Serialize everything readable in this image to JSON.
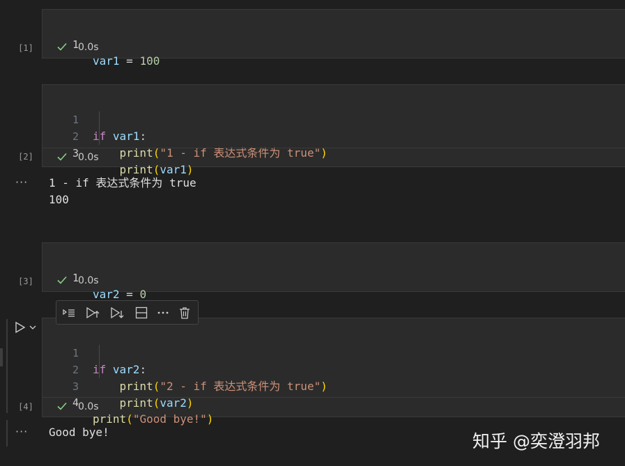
{
  "cells": [
    {
      "exec_count": "[1]",
      "lines": [
        {
          "num": "1",
          "tokens": [
            {
              "t": "var1",
              "c": "v"
            },
            {
              "t": " = ",
              "c": "p"
            },
            {
              "t": "100",
              "c": "n"
            }
          ]
        }
      ],
      "status_time": "0.0s"
    },
    {
      "exec_count": "[2]",
      "lines": [
        {
          "num": "1",
          "tokens": [
            {
              "t": "if",
              "c": "k"
            },
            {
              "t": " ",
              "c": "p"
            },
            {
              "t": "var1",
              "c": "v"
            },
            {
              "t": ":",
              "c": "p"
            }
          ]
        },
        {
          "num": "2",
          "tokens": [
            {
              "t": "    ",
              "c": "p"
            },
            {
              "t": "print",
              "c": "f"
            },
            {
              "t": "(",
              "c": "b"
            },
            {
              "t": "\"1 - if 表达式条件为 true\"",
              "c": "s"
            },
            {
              "t": ")",
              "c": "b"
            }
          ]
        },
        {
          "num": "3",
          "tokens": [
            {
              "t": "    ",
              "c": "p"
            },
            {
              "t": "print",
              "c": "f"
            },
            {
              "t": "(",
              "c": "b"
            },
            {
              "t": "var1",
              "c": "v"
            },
            {
              "t": ")",
              "c": "b"
            }
          ]
        }
      ],
      "status_time": "0.0s",
      "output": "1 - if 表达式条件为 true\n100"
    },
    {
      "exec_count": "[3]",
      "lines": [
        {
          "num": "1",
          "tokens": [
            {
              "t": "var2",
              "c": "v"
            },
            {
              "t": " = ",
              "c": "p"
            },
            {
              "t": "0",
              "c": "n"
            }
          ]
        }
      ],
      "status_time": "0.0s"
    },
    {
      "exec_count": "[4]",
      "lines": [
        {
          "num": "1",
          "tokens": [
            {
              "t": "if",
              "c": "k"
            },
            {
              "t": " ",
              "c": "p"
            },
            {
              "t": "var2",
              "c": "v"
            },
            {
              "t": ":",
              "c": "p"
            }
          ]
        },
        {
          "num": "2",
          "tokens": [
            {
              "t": "    ",
              "c": "p"
            },
            {
              "t": "print",
              "c": "f"
            },
            {
              "t": "(",
              "c": "b"
            },
            {
              "t": "\"2 - if 表达式条件为 true\"",
              "c": "s"
            },
            {
              "t": ")",
              "c": "b"
            }
          ]
        },
        {
          "num": "3",
          "tokens": [
            {
              "t": "    ",
              "c": "p"
            },
            {
              "t": "print",
              "c": "f"
            },
            {
              "t": "(",
              "c": "b"
            },
            {
              "t": "var2",
              "c": "v"
            },
            {
              "t": ")",
              "c": "b"
            }
          ]
        },
        {
          "num": "4",
          "tokens": [
            {
              "t": "print",
              "c": "f"
            },
            {
              "t": "(",
              "c": "b"
            },
            {
              "t": "\"Good bye!\"",
              "c": "s"
            },
            {
              "t": ")",
              "c": "b"
            }
          ]
        }
      ],
      "status_time": "0.0s",
      "output": "Good bye!"
    }
  ],
  "output_menu": "···",
  "toolbar": {
    "icons": [
      "execute-above-icon",
      "run-above-icon",
      "run-below-icon",
      "split-cell-icon",
      "more-icon",
      "delete-icon"
    ]
  },
  "watermark": "知乎 @奕澄羽邦",
  "colors": {
    "keyword": "#c586c0",
    "variable": "#9cdcfe",
    "number": "#b5cea8",
    "function": "#dcdcaa",
    "string": "#ce9178",
    "bracket": "#ffd700",
    "success_check": "#89d185"
  }
}
